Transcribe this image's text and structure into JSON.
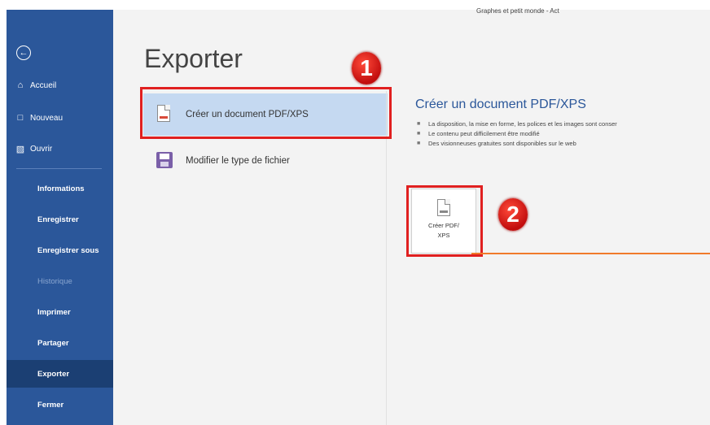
{
  "window": {
    "title": "Graphes et petit monde - Act"
  },
  "sidebar": {
    "back_icon": "circle-arrow-left-icon",
    "top_items": [
      {
        "label": "Accueil",
        "icon": "home-icon"
      },
      {
        "label": "Nouveau",
        "icon": "new-document-icon"
      },
      {
        "label": "Ouvrir",
        "icon": "folder-open-icon"
      }
    ],
    "items": [
      {
        "label": "Informations"
      },
      {
        "label": "Enregistrer"
      },
      {
        "label": "Enregistrer sous"
      },
      {
        "label": "Historique"
      },
      {
        "label": "Imprimer"
      },
      {
        "label": "Partager"
      },
      {
        "label": "Exporter"
      },
      {
        "label": "Fermer"
      }
    ],
    "color": "#2b579a",
    "active_color": "#1b3f73"
  },
  "main": {
    "title": "Exporter",
    "options": [
      {
        "label": "Créer un document PDF/XPS",
        "icon": "pdf-document-icon"
      },
      {
        "label": "Modifier le type de fichier",
        "icon": "save-as-icon"
      }
    ],
    "detail": {
      "title": "Créer un document PDF/XPS",
      "bullets": [
        "La disposition, la mise en forme, les polices et les images sont conser",
        "Le contenu peut difficilement être modifié",
        "Des visionneuses gratuites sont disponibles sur le web"
      ],
      "button_label_line1": "Créer PDF/",
      "button_label_line2": "XPS"
    }
  },
  "annotations": {
    "step1": "1",
    "step2": "2",
    "color": "#e02020",
    "line_color": "#f07a2a"
  }
}
